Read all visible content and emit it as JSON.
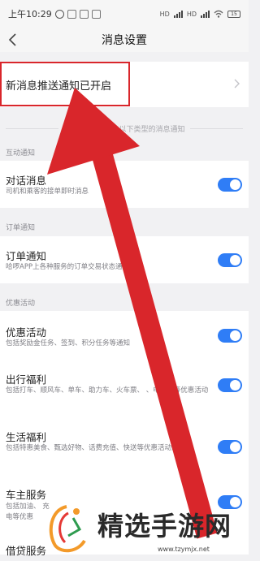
{
  "status_bar": {
    "time": "上午10:29",
    "network": "HD",
    "battery": "15"
  },
  "nav": {
    "title": "消息设置"
  },
  "push_notice": {
    "label": "新消息推送通知已开启"
  },
  "section_tip": {
    "text_left": "您可",
    "text_right": "以下类型的消息通知"
  },
  "groups": {
    "interact": "互动通知",
    "order": "订单通知",
    "promo": "优惠活动"
  },
  "settings": [
    {
      "title": "对话消息",
      "desc": "司机和乘客的接单即时消息",
      "enabled": true
    },
    {
      "title": "订单通知",
      "desc": "哈啰APP上各种服务的订单交易状态通知",
      "enabled": true
    },
    {
      "title": "优惠活动",
      "desc": "包括奖励金任务、签到、积分任务等通知",
      "enabled": true
    },
    {
      "title": "出行福利",
      "desc": "包括打车、顺风车、单车、助力车、火车票、 、电动车等优惠活动",
      "enabled": true
    },
    {
      "title": "生活福利",
      "desc": "包括特惠美食、甄选好物、话费充值、快送等优惠活动通知",
      "enabled": true
    },
    {
      "title": "车主服务",
      "desc": "包括加油、 充电等优惠",
      "enabled": true
    },
    {
      "title": "借贷服务",
      "desc": "",
      "enabled": true
    }
  ],
  "watermark": {
    "text": "精选手游网",
    "url": "www.tzymjx.net"
  },
  "colors": {
    "accent": "#2f7df6",
    "highlight": "#d9262b",
    "background": "#f1f1f3"
  }
}
